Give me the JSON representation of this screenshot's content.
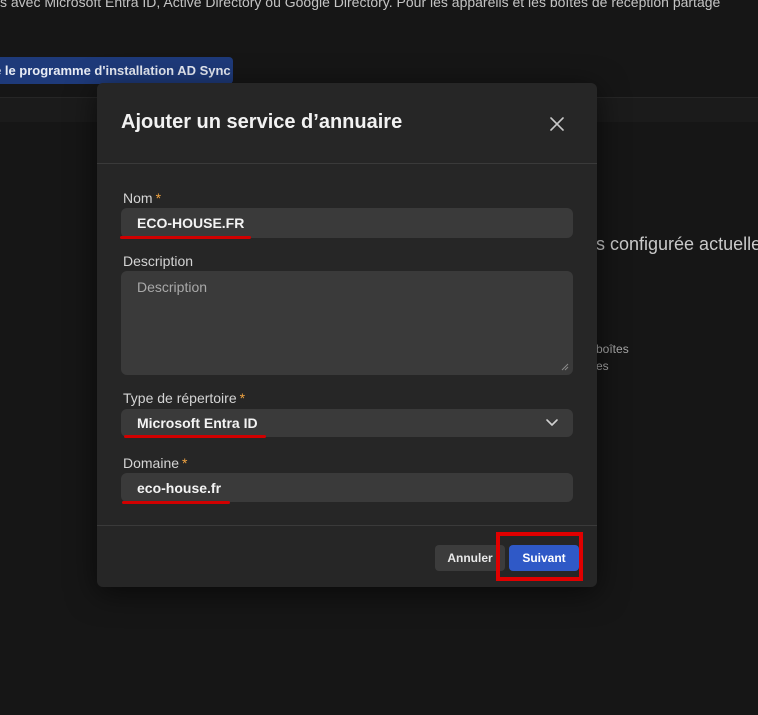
{
  "background": {
    "intro_text": "s avec Microsoft Entra ID, Active Directory ou Google Directory. Pour les appareils et les boîtes de réception partagé",
    "installer_button": "e le programme d'installation AD Sync",
    "heading_fragment": "s configurée actuelle",
    "small_line_1": "boîtes",
    "small_line_2": "es"
  },
  "modal": {
    "title": "Ajouter un service d’annuaire",
    "name": {
      "label": "Nom",
      "required_mark": "*",
      "value": "ECO-HOUSE.FR"
    },
    "description": {
      "label": "Description",
      "placeholder": "Description"
    },
    "directory_type": {
      "label": "Type de répertoire",
      "required_mark": "*",
      "selected": "Microsoft Entra ID"
    },
    "domain": {
      "label": "Domaine",
      "required_mark": "*",
      "value": "eco-house.fr"
    },
    "footer": {
      "cancel_label": "Annuler",
      "next_label": "Suivant"
    }
  },
  "colors": {
    "accent_blue": "#2f59c7",
    "required_orange": "#f0a341",
    "annotation_red": "#d10000"
  },
  "icons": {
    "close": "close-icon",
    "dropdown": "chevron-down-icon",
    "resize": "resize-handle-icon"
  }
}
